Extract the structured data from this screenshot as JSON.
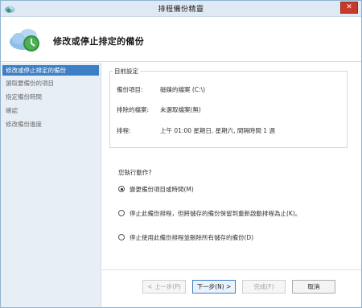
{
  "window": {
    "title": "排程備份精靈",
    "close_label": "✕"
  },
  "header": {
    "title": "修改或停止排定的備份"
  },
  "sidebar": {
    "items": [
      {
        "label": "修改或停止排定的備份",
        "active": true
      },
      {
        "label": "選取要備份的項目",
        "active": false
      },
      {
        "label": "指定備份時間",
        "active": false
      },
      {
        "label": "確認",
        "active": false
      },
      {
        "label": "修改備份進度",
        "active": false
      }
    ]
  },
  "settings": {
    "legend": "目前設定",
    "rows": [
      {
        "label": "備份項目:",
        "value": "磁碟的檔案 (C:\\)"
      },
      {
        "label": "排除的檔案:",
        "value": "未選取檔案(無)"
      },
      {
        "label": "排程:",
        "value": "上午 01:00 星期日, 星期六, 間隔時間 1 週"
      }
    ]
  },
  "question": "您執行動作?",
  "options": [
    {
      "label": "變更備份項目或時間(M)",
      "checked": true
    },
    {
      "label": "停止此備份排程，但將儲存的備份保留到重新啟動排程為止(K)。",
      "checked": false
    },
    {
      "label": "停止使用此備份排程並刪除所有儲存的備份(D)",
      "checked": false
    }
  ],
  "buttons": {
    "prev": "< 上一步(P)",
    "next": "下一步(N) >",
    "finish": "完成(F)",
    "cancel": "取消"
  },
  "colors": {
    "accent": "#3d7fc4",
    "sidebar_bg": "#e8eef6",
    "titlebar_bg": "#dfe9f3",
    "close": "#c7392b"
  }
}
